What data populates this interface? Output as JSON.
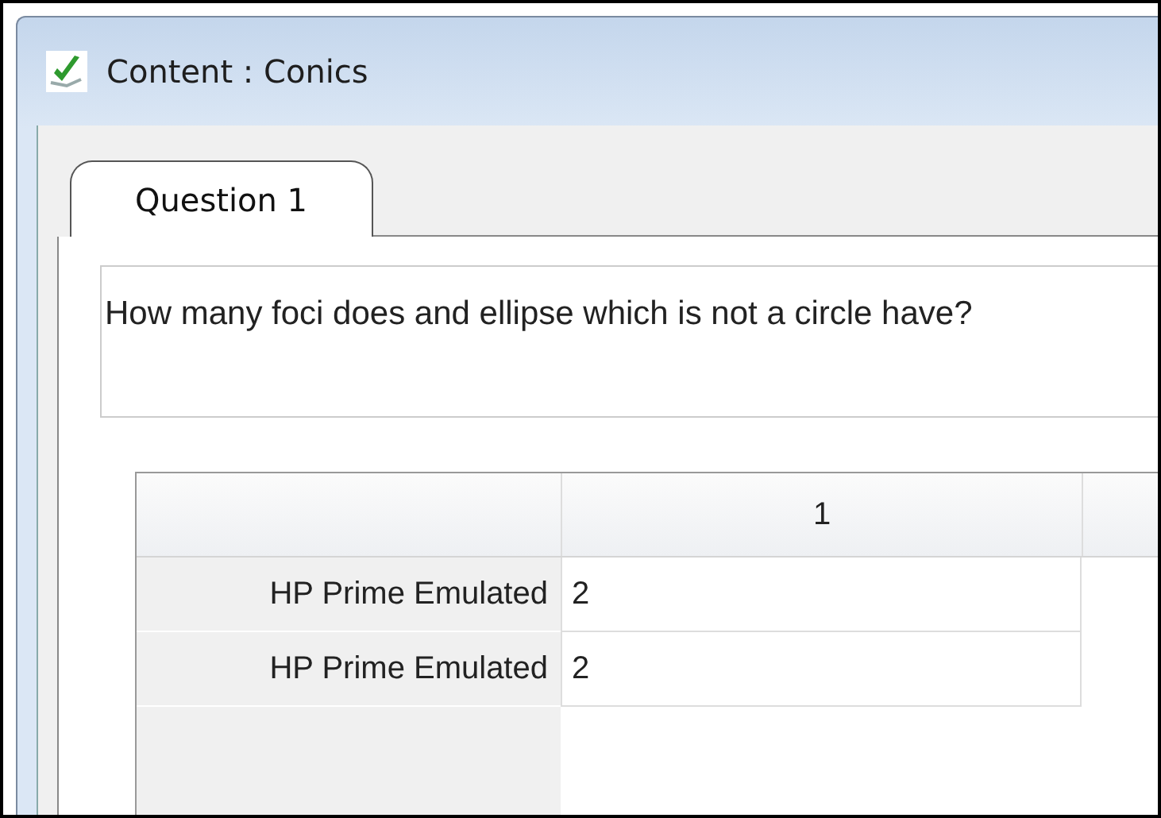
{
  "window": {
    "title": "Content : Conics"
  },
  "tabs": [
    {
      "label": "Question 1",
      "selected": true
    }
  ],
  "question": {
    "text": "How many foci does and ellipse which is not a circle have?"
  },
  "table": {
    "columns": [
      "1"
    ],
    "rows": [
      {
        "header": "HP Prime Emulated",
        "cells": [
          "2"
        ]
      },
      {
        "header": "HP Prime Emulated",
        "cells": [
          "2"
        ]
      }
    ]
  }
}
